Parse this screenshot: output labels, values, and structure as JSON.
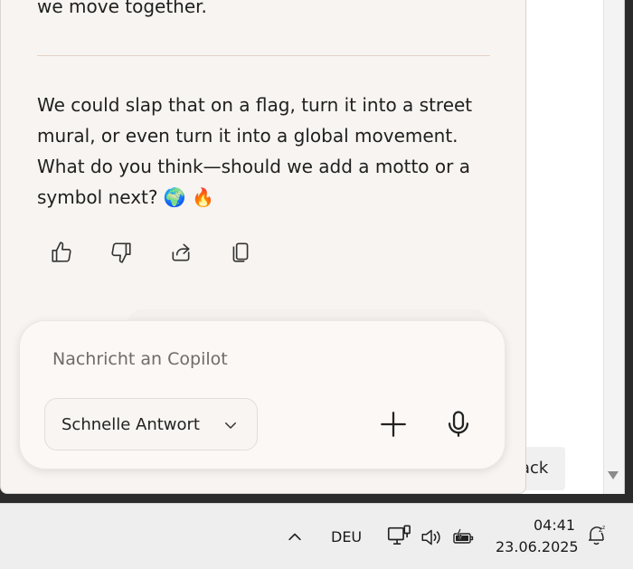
{
  "conversation": {
    "prev_tail": "we move together.",
    "message": "We could slap that on a flag, turn it into a street mural, or even turn it into a global movement. What do you think—should we add a motto or a symbol next? 🌍 🔥",
    "reactions": {
      "like": "thumbs-up-icon",
      "dislike": "thumbs-down-icon",
      "share": "share-icon",
      "copy": "copy-icon"
    }
  },
  "composer": {
    "placeholder": "Nachricht an Copilot",
    "value": "",
    "mode_label": "Schnelle Antwort"
  },
  "background_window": {
    "button_text": "ack"
  },
  "taskbar": {
    "language": "DEU",
    "time": "04:41",
    "date": "23.06.2025"
  },
  "colors": {
    "panel_bg": "#f7f4f1",
    "composer_bg": "#fbf8f6",
    "divider": "#e6d2c6",
    "text": "#1f1f1f",
    "taskbar_bg": "#eeeeee"
  }
}
